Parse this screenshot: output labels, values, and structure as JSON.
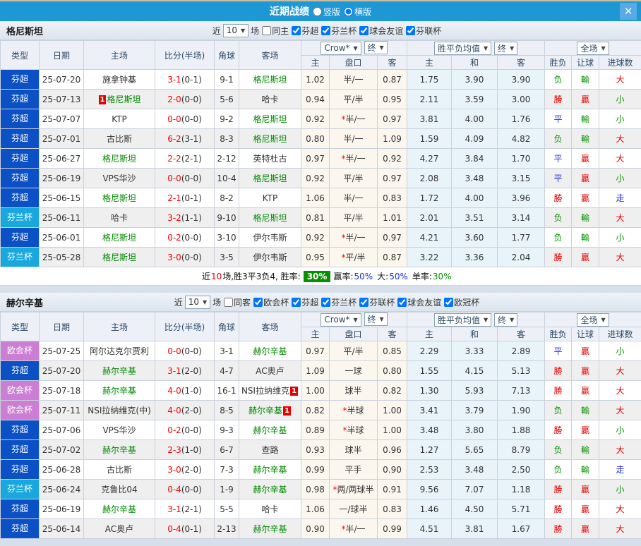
{
  "title_bar": {
    "title": "近期战绩",
    "vertical_label": "竖版",
    "horizontal_label": "横版",
    "selected_layout": "横版",
    "close_label": "✕"
  },
  "controls": {
    "bookmaker": "Crow*",
    "final1": "终",
    "avg_label": "胜平负均值",
    "final2": "终",
    "scope": "全场"
  },
  "columns": {
    "type": "类型",
    "date": "日期",
    "home": "主场",
    "score": "比分(半场)",
    "corner": "角球",
    "away": "客场",
    "odds_home": "主",
    "handicap": "盘口",
    "odds_away": "客",
    "avg_home": "主",
    "avg_draw": "和",
    "avg_away": "客",
    "result": "胜负",
    "handicap_result": "让球",
    "goals": "进球数"
  },
  "league_colors": {
    "芬超": "#0b51c5",
    "芬兰杯": "#18a8dd",
    "欧会杯": "#cb7ed3"
  },
  "result_colors": {
    "red": "#e60000",
    "green": "#089000",
    "blue": "#1f2fd9"
  },
  "sections": [
    {
      "team": "格尼斯坦",
      "filters": {
        "near": "近",
        "count": "10",
        "games": "场",
        "same": "同主",
        "leagues": [
          "芬超",
          "芬兰杯",
          "球会友谊",
          "芬联杯"
        ]
      },
      "rows": [
        {
          "league": "芬超",
          "date": "25-07-20",
          "home": "施拿钟基",
          "home_green": false,
          "home_badge": "",
          "score": "3-1",
          "half": "(0-1)",
          "corner": "9-1",
          "away": "格尼斯坦",
          "away_green": true,
          "away_badge": "",
          "o1": "1.02",
          "hcap": "半/一",
          "o2": "0.87",
          "a1": "1.75",
          "a2": "3.90",
          "a3": "3.90",
          "res": "负",
          "res_c": "green",
          "hres": "輸",
          "hres_c": "green",
          "goal": "大",
          "goal_c": "red"
        },
        {
          "league": "芬超",
          "date": "25-07-13",
          "home": "格尼斯坦",
          "home_green": true,
          "home_badge": "1",
          "score": "2-0",
          "half": "(0-0)",
          "corner": "5-6",
          "away": "哈卡",
          "away_green": false,
          "away_badge": "",
          "o1": "0.94",
          "hcap": "平/半",
          "o2": "0.95",
          "a1": "2.11",
          "a2": "3.59",
          "a3": "3.00",
          "res": "勝",
          "res_c": "red",
          "hres": "贏",
          "hres_c": "red",
          "goal": "小",
          "goal_c": "green"
        },
        {
          "league": "芬超",
          "date": "25-07-07",
          "home": "KTP",
          "home_green": false,
          "home_badge": "",
          "score": "0-0",
          "half": "(0-0)",
          "corner": "9-2",
          "away": "格尼斯坦",
          "away_green": true,
          "away_badge": "",
          "o1": "0.92",
          "hcap": "*半/一",
          "o2": "0.97",
          "a1": "3.81",
          "a2": "4.00",
          "a3": "1.76",
          "res": "平",
          "res_c": "blue",
          "hres": "輸",
          "hres_c": "green",
          "goal": "小",
          "goal_c": "green"
        },
        {
          "league": "芬超",
          "date": "25-07-01",
          "home": "古比斯",
          "home_green": false,
          "home_badge": "",
          "score": "6-2",
          "half": "(3-1)",
          "corner": "8-3",
          "away": "格尼斯坦",
          "away_green": true,
          "away_badge": "",
          "o1": "0.80",
          "hcap": "半/一",
          "o2": "1.09",
          "a1": "1.59",
          "a2": "4.09",
          "a3": "4.82",
          "res": "负",
          "res_c": "green",
          "hres": "輸",
          "hres_c": "green",
          "goal": "大",
          "goal_c": "red"
        },
        {
          "league": "芬超",
          "date": "25-06-27",
          "home": "格尼斯坦",
          "home_green": true,
          "home_badge": "",
          "score": "2-2",
          "half": "(2-1)",
          "corner": "2-12",
          "away": "英特杜古",
          "away_green": false,
          "away_badge": "",
          "o1": "0.97",
          "hcap": "*半/一",
          "o2": "0.92",
          "a1": "4.27",
          "a2": "3.84",
          "a3": "1.70",
          "res": "平",
          "res_c": "blue",
          "hres": "贏",
          "hres_c": "red",
          "goal": "大",
          "goal_c": "red"
        },
        {
          "league": "芬超",
          "date": "25-06-19",
          "home": "VPS华沙",
          "home_green": false,
          "home_badge": "",
          "score": "0-0",
          "half": "(0-0)",
          "corner": "10-4",
          "away": "格尼斯坦",
          "away_green": true,
          "away_badge": "",
          "o1": "0.92",
          "hcap": "平/半",
          "o2": "0.97",
          "a1": "2.08",
          "a2": "3.48",
          "a3": "3.15",
          "res": "平",
          "res_c": "blue",
          "hres": "贏",
          "hres_c": "red",
          "goal": "小",
          "goal_c": "green"
        },
        {
          "league": "芬超",
          "date": "25-06-15",
          "home": "格尼斯坦",
          "home_green": true,
          "home_badge": "",
          "score": "2-1",
          "half": "(0-1)",
          "corner": "8-2",
          "away": "KTP",
          "away_green": false,
          "away_badge": "",
          "o1": "1.06",
          "hcap": "半/一",
          "o2": "0.83",
          "a1": "1.72",
          "a2": "4.00",
          "a3": "3.96",
          "res": "勝",
          "res_c": "red",
          "hres": "贏",
          "hres_c": "red",
          "goal": "走",
          "goal_c": "blue"
        },
        {
          "league": "芬兰杯",
          "date": "25-06-11",
          "home": "哈卡",
          "home_green": false,
          "home_badge": "",
          "score": "3-2",
          "half": "(1-1)",
          "corner": "9-10",
          "away": "格尼斯坦",
          "away_green": true,
          "away_badge": "",
          "o1": "0.81",
          "hcap": "平/半",
          "o2": "1.01",
          "a1": "2.01",
          "a2": "3.51",
          "a3": "3.14",
          "res": "负",
          "res_c": "green",
          "hres": "輸",
          "hres_c": "green",
          "goal": "大",
          "goal_c": "red"
        },
        {
          "league": "芬超",
          "date": "25-06-01",
          "home": "格尼斯坦",
          "home_green": true,
          "home_badge": "",
          "score": "0-2",
          "half": "(0-0)",
          "corner": "3-10",
          "away": "伊尔韦斯",
          "away_green": false,
          "away_badge": "",
          "o1": "0.92",
          "hcap": "*半/一",
          "o2": "0.97",
          "a1": "4.21",
          "a2": "3.60",
          "a3": "1.77",
          "res": "负",
          "res_c": "green",
          "hres": "輸",
          "hres_c": "green",
          "goal": "小",
          "goal_c": "green"
        },
        {
          "league": "芬兰杯",
          "date": "25-05-28",
          "home": "格尼斯坦",
          "home_green": true,
          "home_badge": "",
          "score": "3-0",
          "half": "(0-0)",
          "corner": "3-5",
          "away": "伊尔韦斯",
          "away_green": false,
          "away_badge": "",
          "o1": "0.95",
          "hcap": "*平/半",
          "o2": "0.87",
          "a1": "3.22",
          "a2": "3.36",
          "a3": "2.04",
          "res": "勝",
          "res_c": "red",
          "hres": "贏",
          "hres_c": "red",
          "goal": "大",
          "goal_c": "red"
        }
      ],
      "summary": {
        "pre": "近",
        "count": "10",
        "mid": "场,胜3平3负4, 胜率:",
        "rate": "30%",
        "win_label": "赢率:",
        "win": "50%",
        "big_label": "大:",
        "big": "50%",
        "single_label": "单率:",
        "single": "30%"
      }
    },
    {
      "team": "赫尔辛基",
      "filters": {
        "near": "近",
        "count": "10",
        "games": "场",
        "same": "同客",
        "leagues": [
          "欧会杯",
          "芬超",
          "芬兰杯",
          "芬联杯",
          "球会友谊",
          "欧冠杯"
        ]
      },
      "rows": [
        {
          "league": "欧会杯",
          "date": "25-07-25",
          "home": "阿尔达克尔贾利",
          "home_green": false,
          "home_badge": "",
          "score": "0-0",
          "half": "(0-0)",
          "corner": "3-1",
          "away": "赫尔辛基",
          "away_green": true,
          "away_badge": "",
          "o1": "0.97",
          "hcap": "平/半",
          "o2": "0.85",
          "a1": "2.29",
          "a2": "3.33",
          "a3": "2.89",
          "res": "平",
          "res_c": "blue",
          "hres": "贏",
          "hres_c": "red",
          "goal": "小",
          "goal_c": "green"
        },
        {
          "league": "芬超",
          "date": "25-07-20",
          "home": "赫尔辛基",
          "home_green": true,
          "home_badge": "",
          "score": "3-1",
          "half": "(2-0)",
          "corner": "4-7",
          "away": "AC奥卢",
          "away_green": false,
          "away_badge": "",
          "o1": "1.09",
          "hcap": "一球",
          "o2": "0.80",
          "a1": "1.55",
          "a2": "4.15",
          "a3": "5.13",
          "res": "勝",
          "res_c": "red",
          "hres": "贏",
          "hres_c": "red",
          "goal": "大",
          "goal_c": "red"
        },
        {
          "league": "欧会杯",
          "date": "25-07-18",
          "home": "赫尔辛基",
          "home_green": true,
          "home_badge": "",
          "score": "4-0",
          "half": "(1-0)",
          "corner": "16-1",
          "away": "NSI拉纳维克",
          "away_green": false,
          "away_badge": "1",
          "o1": "1.00",
          "hcap": "球半",
          "o2": "0.82",
          "a1": "1.30",
          "a2": "5.93",
          "a3": "7.13",
          "res": "勝",
          "res_c": "red",
          "hres": "贏",
          "hres_c": "red",
          "goal": "大",
          "goal_c": "red"
        },
        {
          "league": "欧会杯",
          "date": "25-07-11",
          "home": "NSI拉纳维克(中)",
          "home_green": false,
          "home_badge": "",
          "score": "4-0",
          "half": "(2-0)",
          "corner": "8-5",
          "away": "赫尔辛基",
          "away_green": true,
          "away_badge": "1",
          "o1": "0.82",
          "hcap": "*半球",
          "o2": "1.00",
          "a1": "3.41",
          "a2": "3.79",
          "a3": "1.90",
          "res": "负",
          "res_c": "green",
          "hres": "輸",
          "hres_c": "green",
          "goal": "大",
          "goal_c": "red"
        },
        {
          "league": "芬超",
          "date": "25-07-06",
          "home": "VPS华沙",
          "home_green": false,
          "home_badge": "",
          "score": "0-2",
          "half": "(0-0)",
          "corner": "9-3",
          "away": "赫尔辛基",
          "away_green": true,
          "away_badge": "",
          "o1": "0.89",
          "hcap": "*半球",
          "o2": "1.00",
          "a1": "3.48",
          "a2": "3.80",
          "a3": "1.88",
          "res": "勝",
          "res_c": "red",
          "hres": "贏",
          "hres_c": "red",
          "goal": "小",
          "goal_c": "green"
        },
        {
          "league": "芬超",
          "date": "25-07-02",
          "home": "赫尔辛基",
          "home_green": true,
          "home_badge": "",
          "score": "2-3",
          "half": "(1-0)",
          "corner": "6-7",
          "away": "查路",
          "away_green": false,
          "away_badge": "",
          "o1": "0.93",
          "hcap": "球半",
          "o2": "0.96",
          "a1": "1.27",
          "a2": "5.65",
          "a3": "8.79",
          "res": "负",
          "res_c": "green",
          "hres": "輸",
          "hres_c": "green",
          "goal": "大",
          "goal_c": "red"
        },
        {
          "league": "芬超",
          "date": "25-06-28",
          "home": "古比斯",
          "home_green": false,
          "home_badge": "",
          "score": "3-0",
          "half": "(2-0)",
          "corner": "7-3",
          "away": "赫尔辛基",
          "away_green": true,
          "away_badge": "",
          "o1": "0.99",
          "hcap": "平手",
          "o2": "0.90",
          "a1": "2.53",
          "a2": "3.48",
          "a3": "2.50",
          "res": "负",
          "res_c": "green",
          "hres": "輸",
          "hres_c": "green",
          "goal": "走",
          "goal_c": "blue"
        },
        {
          "league": "芬兰杯",
          "date": "25-06-24",
          "home": "克鲁比04",
          "home_green": false,
          "home_badge": "",
          "score": "0-4",
          "half": "(0-0)",
          "corner": "1-9",
          "away": "赫尔辛基",
          "away_green": true,
          "away_badge": "",
          "o1": "0.98",
          "hcap": "*两/两球半",
          "o2": "0.91",
          "a1": "9.56",
          "a2": "7.07",
          "a3": "1.18",
          "res": "勝",
          "res_c": "red",
          "hres": "贏",
          "hres_c": "red",
          "goal": "小",
          "goal_c": "green"
        },
        {
          "league": "芬超",
          "date": "25-06-19",
          "home": "赫尔辛基",
          "home_green": true,
          "home_badge": "",
          "score": "3-1",
          "half": "(2-1)",
          "corner": "5-5",
          "away": "哈卡",
          "away_green": false,
          "away_badge": "",
          "o1": "1.06",
          "hcap": "一/球半",
          "o2": "0.83",
          "a1": "1.46",
          "a2": "4.50",
          "a3": "5.71",
          "res": "勝",
          "res_c": "red",
          "hres": "贏",
          "hres_c": "red",
          "goal": "大",
          "goal_c": "red"
        },
        {
          "league": "芬超",
          "date": "25-06-14",
          "home": "AC奥卢",
          "home_green": false,
          "home_badge": "",
          "score": "0-4",
          "half": "(0-1)",
          "corner": "2-13",
          "away": "赫尔辛基",
          "away_green": true,
          "away_badge": "",
          "o1": "0.90",
          "hcap": "*半/一",
          "o2": "0.99",
          "a1": "4.51",
          "a2": "3.81",
          "a3": "1.67",
          "res": "勝",
          "res_c": "red",
          "hres": "贏",
          "hres_c": "red",
          "goal": "大",
          "goal_c": "red"
        }
      ],
      "summary": null
    }
  ]
}
